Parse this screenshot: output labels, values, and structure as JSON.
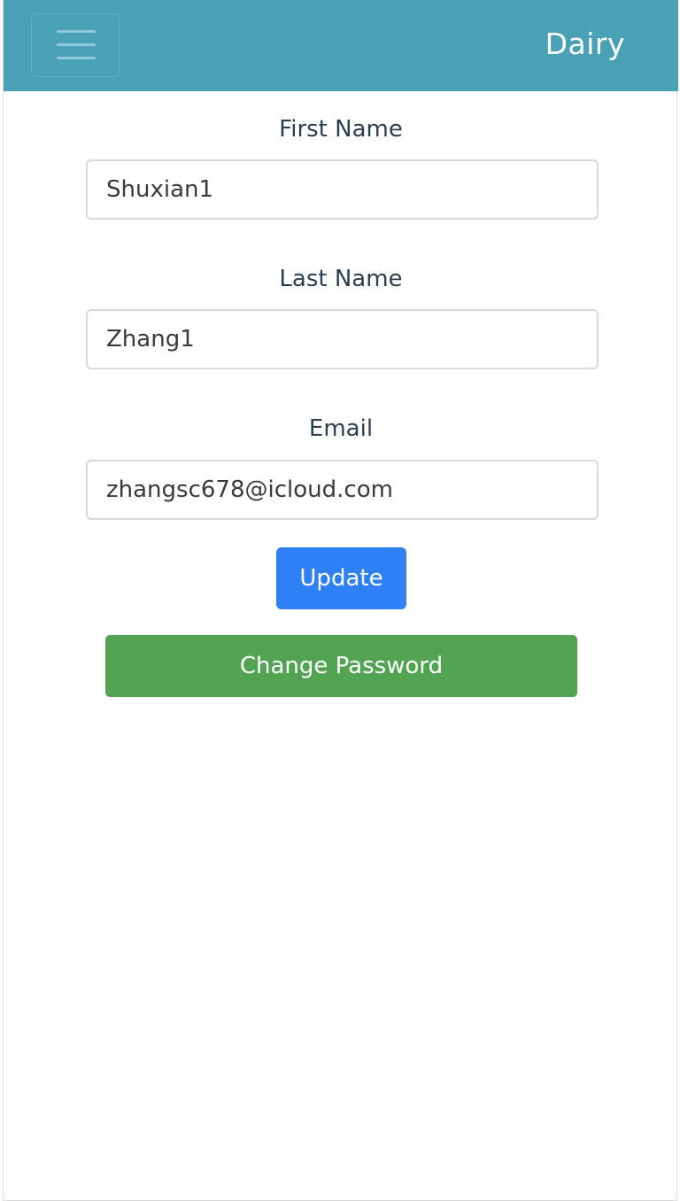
{
  "navbar": {
    "brand": "Dairy",
    "menu_icon": "hamburger-menu-icon",
    "background_color": "#4aa1b5"
  },
  "form": {
    "first_name": {
      "label": "First Name",
      "value": "Shuxian1"
    },
    "last_name": {
      "label": "Last Name",
      "value": "Zhang1"
    },
    "email": {
      "label": "Email",
      "value": "zhangsc678@icloud.com"
    },
    "update_label": "Update",
    "change_password_label": "Change Password"
  },
  "colors": {
    "update_button": "#2f80f5",
    "change_password_button": "#52a452",
    "label_text": "#2c3e50"
  }
}
